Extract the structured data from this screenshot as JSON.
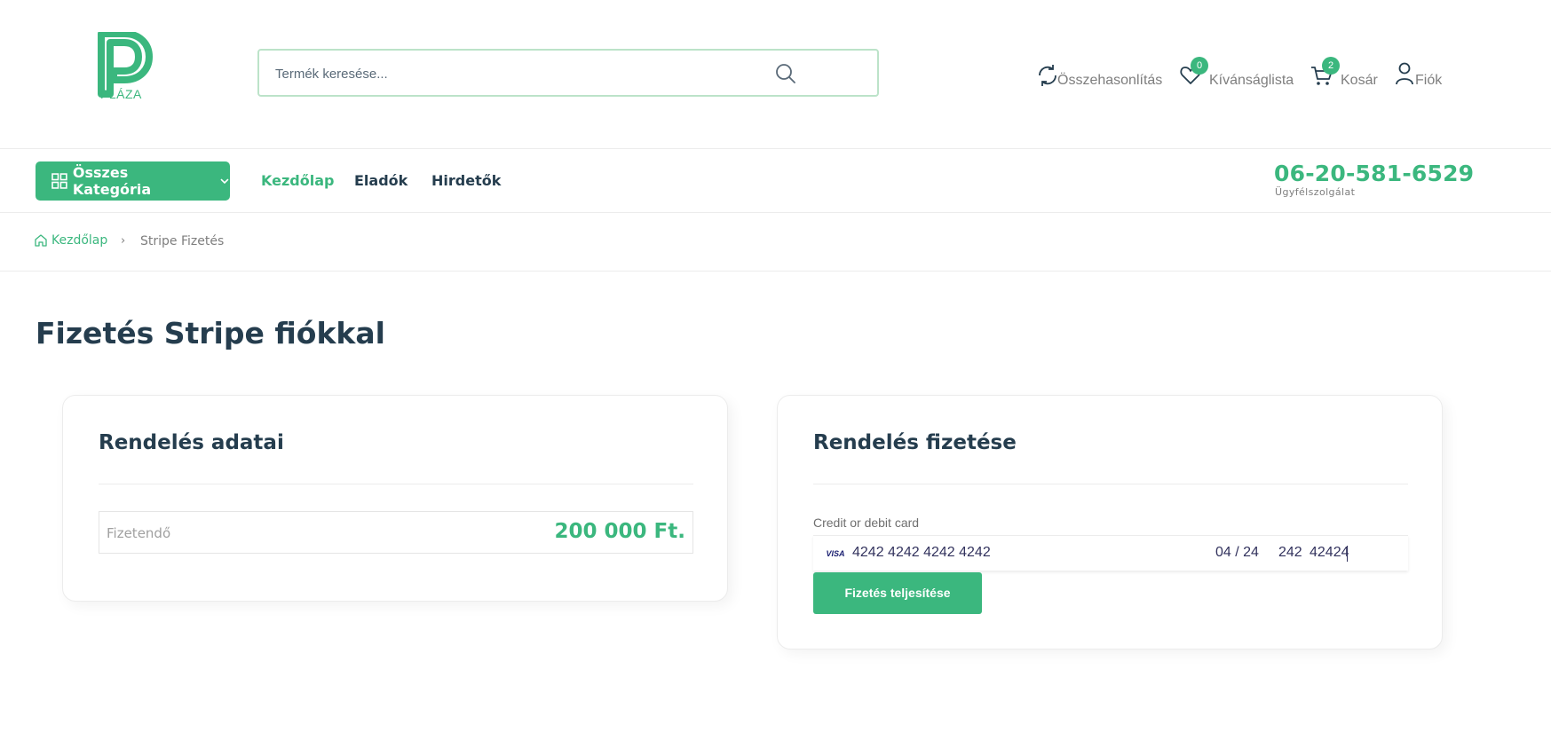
{
  "brand": {
    "name": "PLÁZA",
    "color": "#3bb77e"
  },
  "search": {
    "placeholder": "Termék keresése...",
    "value": "",
    "icon": "search-icon"
  },
  "header_actions": {
    "compare": {
      "label": "Összehasonlítás",
      "icon": "refresh-icon"
    },
    "wishlist": {
      "label": "Kívánságlista",
      "count": "0",
      "icon": "heart-icon"
    },
    "cart": {
      "label": "Kosár",
      "count": "2",
      "icon": "cart-icon"
    },
    "account": {
      "label": "Fiók",
      "icon": "user-icon"
    }
  },
  "nav": {
    "categories_button": "Összes Kategória",
    "links": [
      "Kezdőlap",
      "Eladók",
      "Hirdetők"
    ],
    "active_link": "Kezdőlap",
    "phone": "06-20-581-6529",
    "phone_label": "Ügyfélszolgálat"
  },
  "breadcrumb": {
    "home": "Kezdőlap",
    "separator": "›",
    "current": "Stripe Fizetés"
  },
  "page_title": "Fizetés Stripe fiókkal",
  "order_details": {
    "title": "Rendelés adatai",
    "total_label": "Fizetendő",
    "total_value": "200 000 Ft."
  },
  "order_payment": {
    "title": "Rendelés fizetése",
    "card_label": "Credit or debit card",
    "card_brand": "VISA",
    "card_number": "4242 4242 4242 4242",
    "expiry": "04 / 24",
    "cvc": "242",
    "postal": "42424",
    "submit_label": "Fizetés teljesítése"
  }
}
